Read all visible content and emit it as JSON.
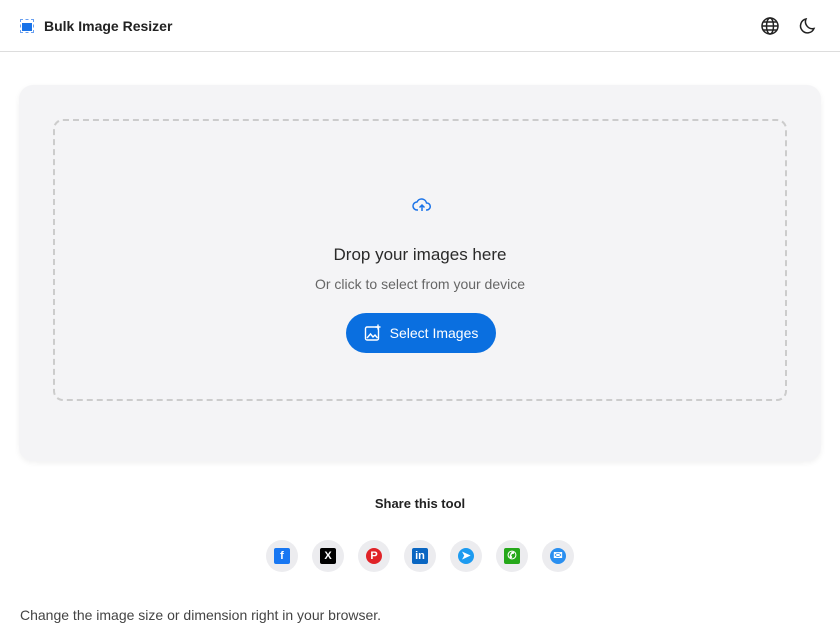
{
  "header": {
    "title": "Bulk Image Resizer",
    "icons": [
      "globe-icon",
      "moon-icon"
    ]
  },
  "upload": {
    "heading": "Drop your images here",
    "subtext": "Or click to select from your device",
    "button": "Select Images"
  },
  "share": {
    "title": "Share this tool",
    "networks": [
      {
        "name": "facebook",
        "glyph": "f",
        "color": "#1877f2"
      },
      {
        "name": "x",
        "glyph": "X",
        "color": "#000000"
      },
      {
        "name": "pinterest",
        "glyph": "P",
        "color": "#e02328"
      },
      {
        "name": "linkedin",
        "glyph": "in",
        "color": "#0a66c2"
      },
      {
        "name": "telegram",
        "glyph": "➤",
        "color": "#1d9bf0"
      },
      {
        "name": "whatsapp",
        "glyph": "✆",
        "color": "#25a81a"
      },
      {
        "name": "email",
        "glyph": "✉",
        "color": "#2a8ff0"
      }
    ]
  },
  "footer": {
    "description": "Change the image size or dimension right in your browser."
  },
  "colors": {
    "accent": "#0a6fe0"
  }
}
